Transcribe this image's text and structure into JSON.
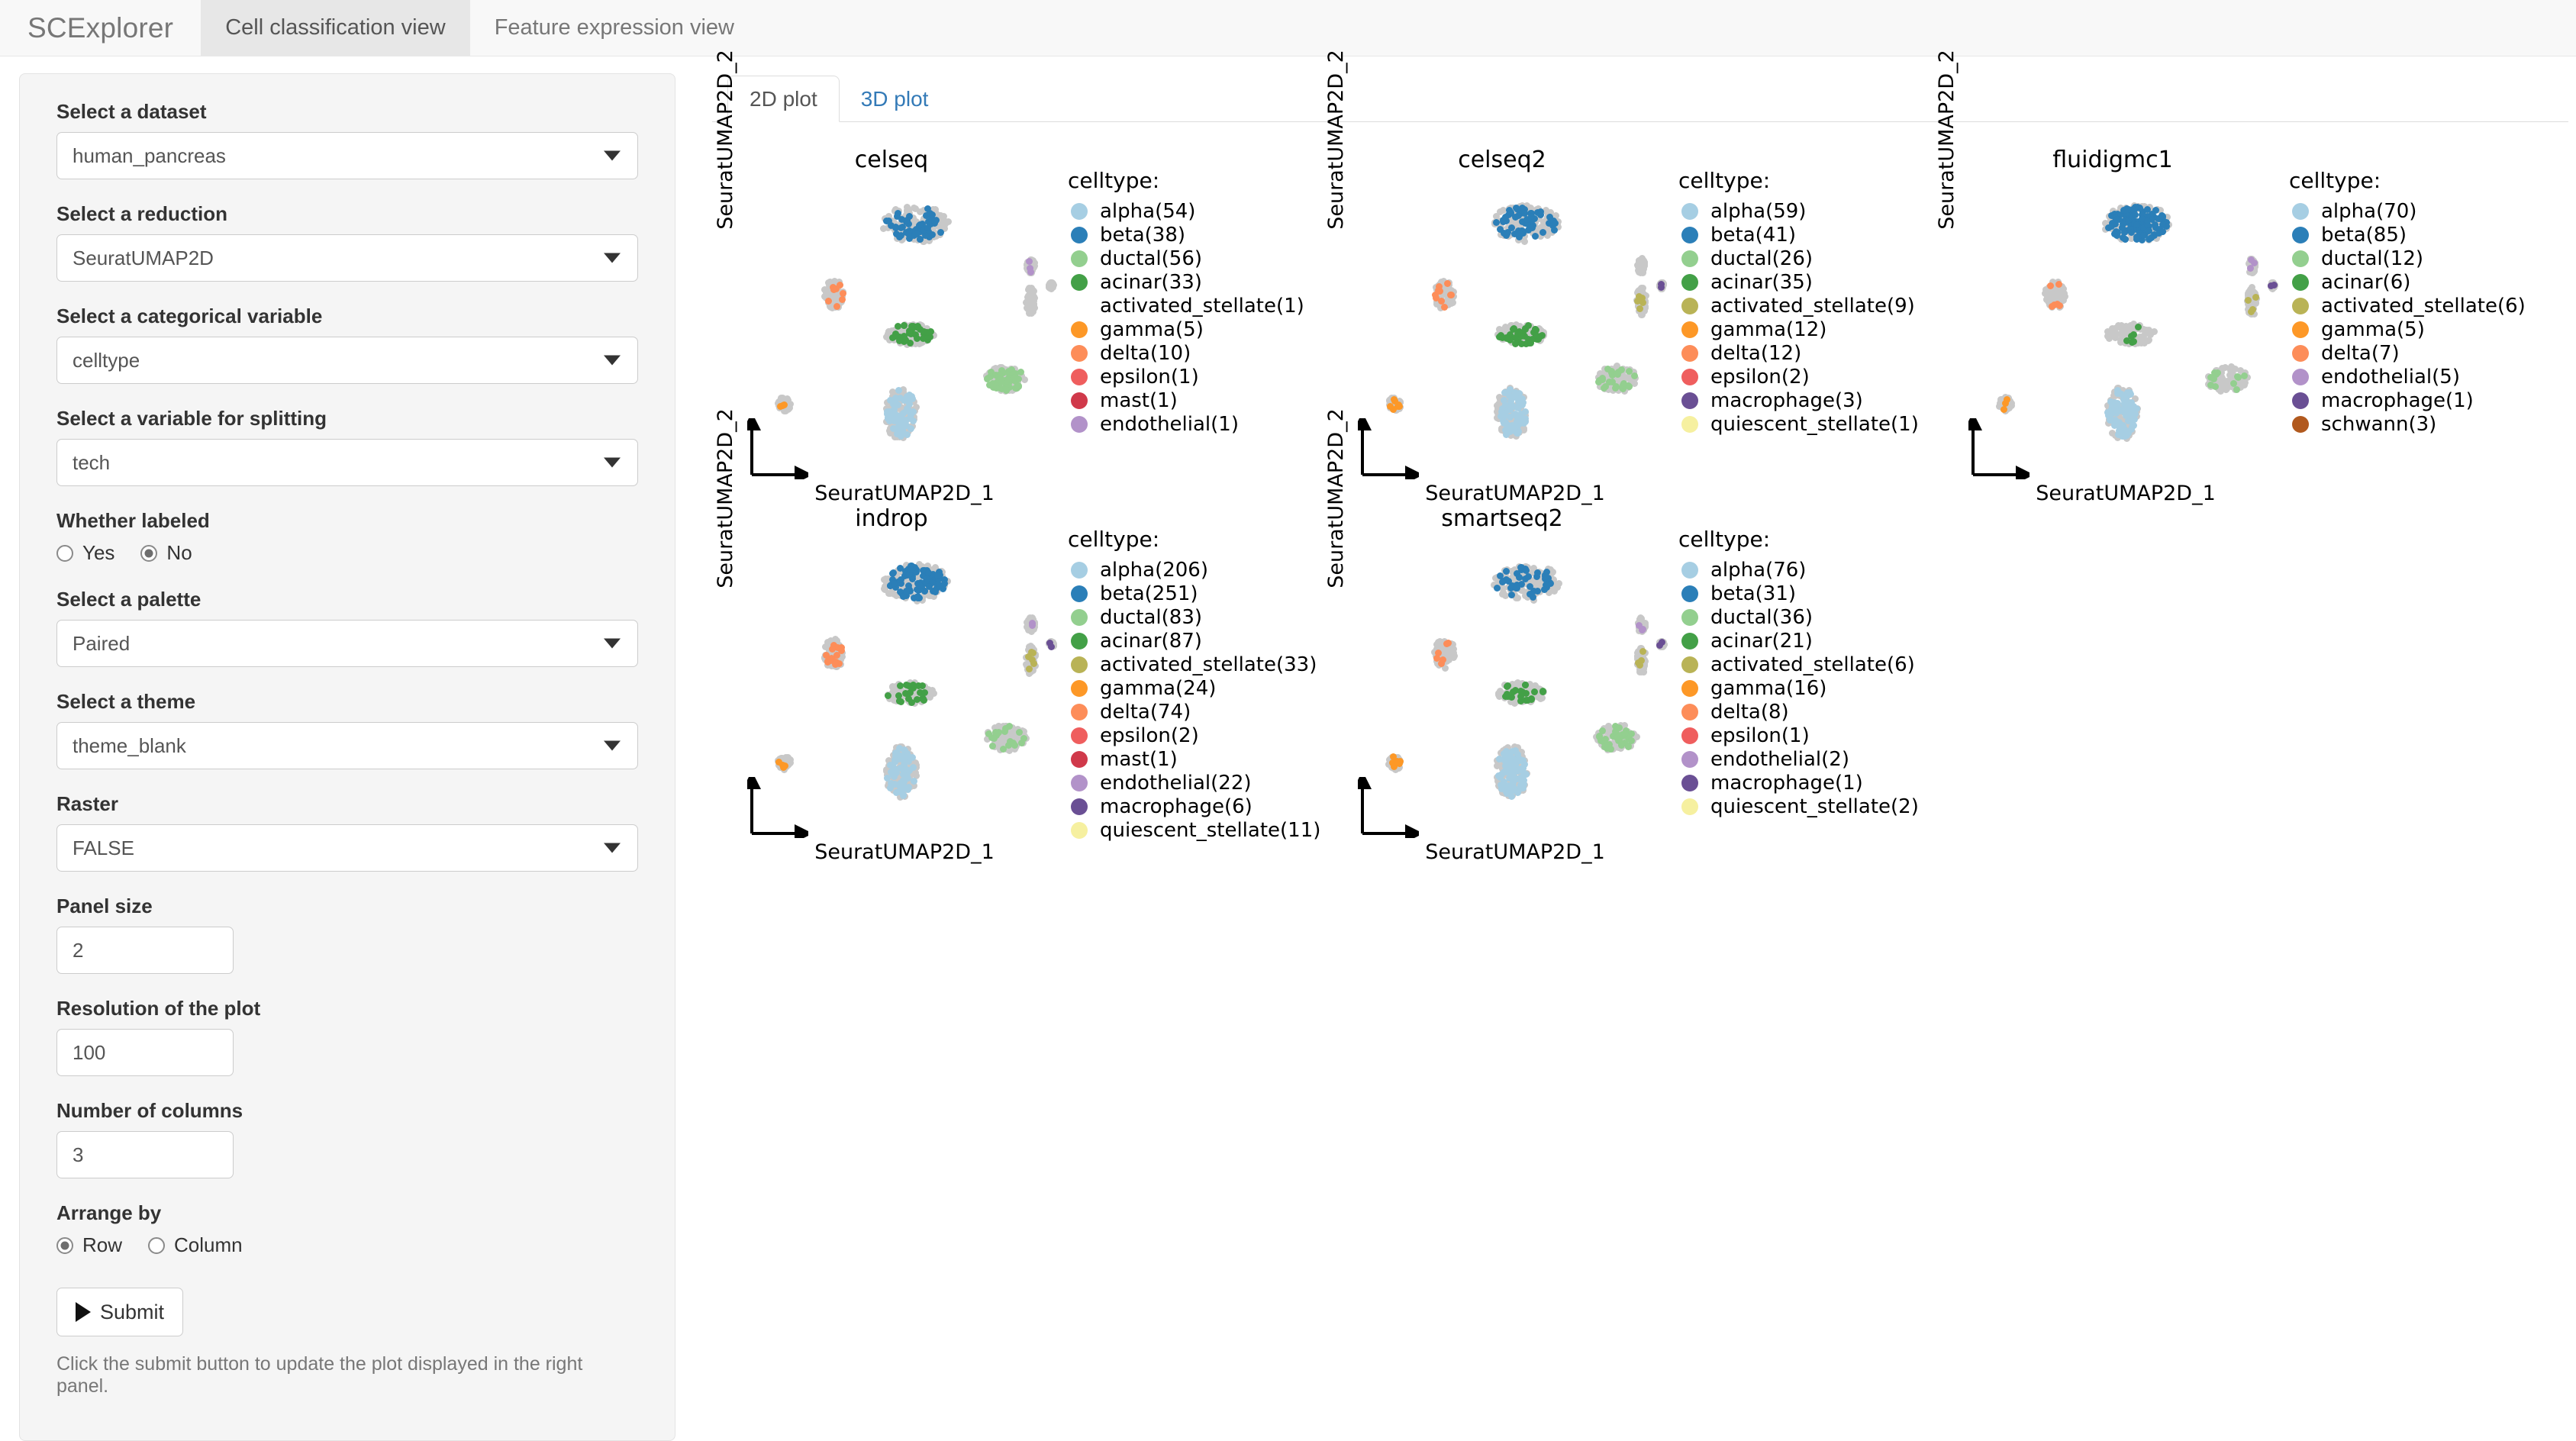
{
  "navbar": {
    "brand": "SCExplorer",
    "tabs": [
      {
        "label": "Cell classification view",
        "active": true
      },
      {
        "label": "Feature expression view",
        "active": false
      }
    ]
  },
  "sidebar": {
    "fields": [
      {
        "label": "Select a dataset",
        "value": "human_pancreas",
        "type": "select",
        "name": "dataset"
      },
      {
        "label": "Select a reduction",
        "value": "SeuratUMAP2D",
        "type": "select",
        "name": "reduction"
      },
      {
        "label": "Select a categorical variable",
        "value": "celltype",
        "type": "select",
        "name": "categorical-variable"
      },
      {
        "label": "Select a variable for splitting",
        "value": "tech",
        "type": "select",
        "name": "split-variable"
      }
    ],
    "labeled": {
      "label": "Whether labeled",
      "options": [
        {
          "label": "Yes",
          "checked": false
        },
        {
          "label": "No",
          "checked": true
        }
      ]
    },
    "fields2": [
      {
        "label": "Select a palette",
        "value": "Paired",
        "type": "select",
        "name": "palette"
      },
      {
        "label": "Select a theme",
        "value": "theme_blank",
        "type": "select",
        "name": "theme"
      },
      {
        "label": "Raster",
        "value": "FALSE",
        "type": "select",
        "name": "raster"
      }
    ],
    "numbers": [
      {
        "label": "Panel size",
        "value": "2",
        "name": "panel-size"
      },
      {
        "label": "Resolution of the plot",
        "value": "100",
        "name": "resolution"
      },
      {
        "label": "Number of columns",
        "value": "3",
        "name": "num-columns"
      }
    ],
    "arrange": {
      "label": "Arrange by",
      "options": [
        {
          "label": "Row",
          "checked": true
        },
        {
          "label": "Column",
          "checked": false
        }
      ]
    },
    "submit_label": "Submit",
    "hint": "Click the submit button to update the plot displayed in the right panel."
  },
  "main": {
    "tabs": [
      {
        "label": "2D plot",
        "active": true
      },
      {
        "label": "3D plot",
        "active": false
      }
    ]
  },
  "chart_data": {
    "type": "scatter",
    "xlabel": "SeuratUMAP2D_1",
    "ylabel": "SeuratUMAP2D_2",
    "legend_title": "celltype:",
    "split_by": "tech",
    "grid": false,
    "legend_position": "right",
    "background_color": "#c8c8c8",
    "palette": {
      "alpha": "#a6cee3",
      "beta": "#2b7fb8",
      "ductal": "#93cf8f",
      "acinar": "#43a047",
      "activated_stellate": "#bdb martens",
      "gamma": "#fd9827",
      "delta": "#fd8d59",
      "epsilon": "#ef5e5e",
      "mast": "#d0394a",
      "endothelial": "#b292c9",
      "macrophage": "#6a4f94",
      "quiescent_stellate": "#f6f0a0",
      "schwann": "#b1591e"
    },
    "panels": [
      {
        "title": "celseq",
        "legend": [
          {
            "label": "alpha(54)",
            "celltype": "alpha",
            "count": 54,
            "color": "#a6cee3"
          },
          {
            "label": "beta(38)",
            "celltype": "beta",
            "count": 38,
            "color": "#2b7fb8"
          },
          {
            "label": "ductal(56)",
            "celltype": "ductal",
            "count": 56,
            "color": "#93cf8f"
          },
          {
            "label": "acinar(33)",
            "celltype": "acinar",
            "count": 33,
            "color": "#43a047"
          },
          {
            "label": "activated_stellate(1)",
            "celltype": "activated_stellate",
            "count": 1,
            "color": "#bdb濃"
          },
          {
            "label": "gamma(5)",
            "celltype": "gamma",
            "count": 5,
            "color": "#fd9827"
          },
          {
            "label": "delta(10)",
            "celltype": "delta",
            "count": 10,
            "color": "#fd8d59"
          },
          {
            "label": "epsilon(1)",
            "celltype": "epsilon",
            "count": 1,
            "color": "#ef5e5e"
          },
          {
            "label": "mast(1)",
            "celltype": "mast",
            "count": 1,
            "color": "#d0394a"
          },
          {
            "label": "endothelial(1)",
            "celltype": "endothelial",
            "count": 1,
            "color": "#b292c9"
          }
        ]
      },
      {
        "title": "celseq2",
        "legend": [
          {
            "label": "alpha(59)",
            "celltype": "alpha",
            "count": 59,
            "color": "#a6cee3"
          },
          {
            "label": "beta(41)",
            "celltype": "beta",
            "count": 41,
            "color": "#2b7fb8"
          },
          {
            "label": "ductal(26)",
            "celltype": "ductal",
            "count": 26,
            "color": "#93cf8f"
          },
          {
            "label": "acinar(35)",
            "celltype": "acinar",
            "count": 35,
            "color": "#43a047"
          },
          {
            "label": "activated_stellate(9)",
            "celltype": "activated_stellate",
            "count": 9,
            "color": "#b9b356"
          },
          {
            "label": "gamma(12)",
            "celltype": "gamma",
            "count": 12,
            "color": "#fd9827"
          },
          {
            "label": "delta(12)",
            "celltype": "delta",
            "count": 12,
            "color": "#fd8d59"
          },
          {
            "label": "epsilon(2)",
            "celltype": "epsilon",
            "count": 2,
            "color": "#ef5e5e"
          },
          {
            "label": "macrophage(3)",
            "celltype": "macrophage",
            "count": 3,
            "color": "#6a4f94"
          },
          {
            "label": "quiescent_stellate(1)",
            "celltype": "quiescent_stellate",
            "count": 1,
            "color": "#f6f0a0"
          }
        ]
      },
      {
        "title": "fluidigmc1",
        "legend": [
          {
            "label": "alpha(70)",
            "celltype": "alpha",
            "count": 70,
            "color": "#a6cee3"
          },
          {
            "label": "beta(85)",
            "celltype": "beta",
            "count": 85,
            "color": "#2b7fb8"
          },
          {
            "label": "ductal(12)",
            "celltype": "ductal",
            "count": 12,
            "color": "#93cf8f"
          },
          {
            "label": "acinar(6)",
            "celltype": "acinar",
            "count": 6,
            "color": "#43a047"
          },
          {
            "label": "activated_stellate(6)",
            "celltype": "activated_stellate",
            "count": 6,
            "color": "#b9b356"
          },
          {
            "label": "gamma(5)",
            "celltype": "gamma",
            "count": 5,
            "color": "#fd9827"
          },
          {
            "label": "delta(7)",
            "celltype": "delta",
            "count": 7,
            "color": "#fd8d59"
          },
          {
            "label": "endothelial(5)",
            "celltype": "endothelial",
            "count": 5,
            "color": "#b292c9"
          },
          {
            "label": "macrophage(1)",
            "celltype": "macrophage",
            "count": 1,
            "color": "#6a4f94"
          },
          {
            "label": "schwann(3)",
            "celltype": "schwann",
            "count": 3,
            "color": "#b1591e"
          }
        ]
      },
      {
        "title": "indrop",
        "legend": [
          {
            "label": "alpha(206)",
            "celltype": "alpha",
            "count": 206,
            "color": "#a6cee3"
          },
          {
            "label": "beta(251)",
            "celltype": "beta",
            "count": 251,
            "color": "#2b7fb8"
          },
          {
            "label": "ductal(83)",
            "celltype": "ductal",
            "count": 83,
            "color": "#93cf8f"
          },
          {
            "label": "acinar(87)",
            "celltype": "acinar",
            "count": 87,
            "color": "#43a047"
          },
          {
            "label": "activated_stellate(33)",
            "celltype": "activated_stellate",
            "count": 33,
            "color": "#b9b356"
          },
          {
            "label": "gamma(24)",
            "celltype": "gamma",
            "count": 24,
            "color": "#fd9827"
          },
          {
            "label": "delta(74)",
            "celltype": "delta",
            "count": 74,
            "color": "#fd8d59"
          },
          {
            "label": "epsilon(2)",
            "celltype": "epsilon",
            "count": 2,
            "color": "#ef5e5e"
          },
          {
            "label": "mast(1)",
            "celltype": "mast",
            "count": 1,
            "color": "#d0394a"
          },
          {
            "label": "endothelial(22)",
            "celltype": "endothelial",
            "count": 22,
            "color": "#b292c9"
          },
          {
            "label": "macrophage(6)",
            "celltype": "macrophage",
            "count": 6,
            "color": "#6a4f94"
          },
          {
            "label": "quiescent_stellate(11)",
            "celltype": "quiescent_stellate",
            "count": 11,
            "color": "#f6f0a0"
          }
        ]
      },
      {
        "title": "smartseq2",
        "legend": [
          {
            "label": "alpha(76)",
            "celltype": "alpha",
            "count": 76,
            "color": "#a6cee3"
          },
          {
            "label": "beta(31)",
            "celltype": "beta",
            "count": 31,
            "color": "#2b7fb8"
          },
          {
            "label": "ductal(36)",
            "celltype": "ductal",
            "count": 36,
            "color": "#93cf8f"
          },
          {
            "label": "acinar(21)",
            "celltype": "acinar",
            "count": 21,
            "color": "#43a047"
          },
          {
            "label": "activated_stellate(6)",
            "celltype": "activated_stellate",
            "count": 6,
            "color": "#b9b356"
          },
          {
            "label": "gamma(16)",
            "celltype": "gamma",
            "count": 16,
            "color": "#fd9827"
          },
          {
            "label": "delta(8)",
            "celltype": "delta",
            "count": 8,
            "color": "#fd8d59"
          },
          {
            "label": "epsilon(1)",
            "celltype": "epsilon",
            "count": 1,
            "color": "#ef5e5e"
          },
          {
            "label": "endothelial(2)",
            "celltype": "endothelial",
            "count": 2,
            "color": "#b292c9"
          },
          {
            "label": "macrophage(1)",
            "celltype": "macrophage",
            "count": 1,
            "color": "#6a4f94"
          },
          {
            "label": "quiescent_stellate(2)",
            "celltype": "quiescent_stellate",
            "count": 2,
            "color": "#f6f0a0"
          }
        ]
      }
    ],
    "clusters": [
      {
        "celltype": "beta",
        "cx": 0.52,
        "cy": 0.16,
        "rx": 0.115,
        "ry": 0.07
      },
      {
        "celltype": "delta",
        "cx": 0.24,
        "cy": 0.43,
        "rx": 0.035,
        "ry": 0.055
      },
      {
        "celltype": "acinar",
        "cx": 0.5,
        "cy": 0.58,
        "rx": 0.085,
        "ry": 0.04
      },
      {
        "celltype": "ductal",
        "cx": 0.83,
        "cy": 0.75,
        "rx": 0.07,
        "ry": 0.05
      },
      {
        "celltype": "alpha",
        "cx": 0.47,
        "cy": 0.88,
        "rx": 0.055,
        "ry": 0.1
      },
      {
        "celltype": "gamma",
        "cx": 0.07,
        "cy": 0.845,
        "rx": 0.022,
        "ry": 0.026
      },
      {
        "celltype": "activated_stellate",
        "cx": 0.915,
        "cy": 0.455,
        "rx": 0.016,
        "ry": 0.055
      },
      {
        "celltype": "endothelial",
        "cx": 0.915,
        "cy": 0.32,
        "rx": 0.014,
        "ry": 0.028
      },
      {
        "celltype": "macrophage",
        "cx": 0.985,
        "cy": 0.395,
        "rx": 0.009,
        "ry": 0.012
      }
    ]
  }
}
